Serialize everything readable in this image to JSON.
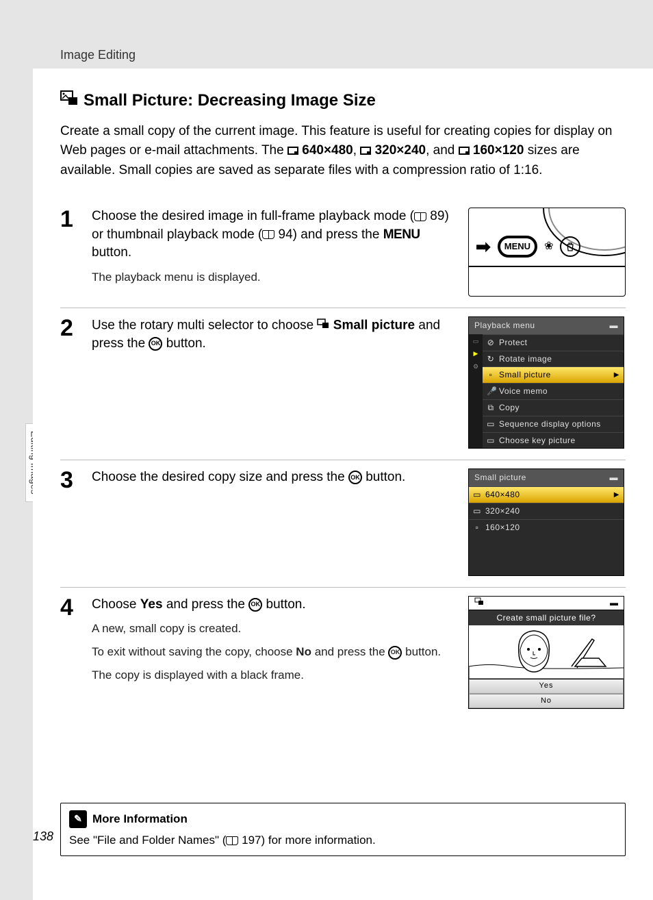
{
  "header": {
    "breadcrumb": "Image Editing"
  },
  "title": "Small Picture: Decreasing Image Size",
  "intro": {
    "text_before_sizes": "Create a small copy of the current image. This feature is useful for creating copies for display on Web pages or e-mail attachments. The ",
    "size1": "640×480",
    "between1": ", ",
    "size2": "320×240",
    "between2": ", and ",
    "size3": "160×120",
    "text_after_sizes": " sizes are available. Small copies are saved as separate files with a compression ratio of 1:16."
  },
  "steps": [
    {
      "num": "1",
      "main_a": "Choose the desired image in full-frame playback mode (",
      "ref1": "89",
      "main_b": ") or thumbnail playback mode (",
      "ref2": "94",
      "main_c": ") and press the ",
      "menu_word": "MENU",
      "main_d": " button.",
      "sub": "The playback menu is displayed.",
      "figure": "camera"
    },
    {
      "num": "2",
      "main_a": "Use the rotary multi selector to choose ",
      "bold1": "Small picture",
      "main_b": " and press the ",
      "main_c": " button.",
      "figure": "playback_menu"
    },
    {
      "num": "3",
      "main_a": "Choose the desired copy size and press the ",
      "main_b": " button.",
      "figure": "size_menu"
    },
    {
      "num": "4",
      "main_a": "Choose ",
      "bold1": "Yes",
      "main_b": " and press the ",
      "main_c": " button.",
      "sub1": "A new, small copy is created.",
      "sub2a": "To exit without saving the copy, choose ",
      "sub2_bold": "No",
      "sub2b": " and press the ",
      "sub2c": " button.",
      "sub3": "The copy is displayed with a black frame.",
      "figure": "confirm"
    }
  ],
  "camera": {
    "menu_label": "MENU"
  },
  "playback_menu": {
    "title": "Playback menu",
    "items": [
      {
        "icon": "⊘",
        "label": "Protect"
      },
      {
        "icon": "↻",
        "label": "Rotate image"
      },
      {
        "icon": "▫",
        "label": "Small picture",
        "selected": true
      },
      {
        "icon": "🎤",
        "label": "Voice memo"
      },
      {
        "icon": "⧉",
        "label": "Copy"
      },
      {
        "icon": "▭",
        "label": "Sequence display options"
      },
      {
        "icon": "▭",
        "label": "Choose key picture"
      }
    ]
  },
  "size_menu": {
    "title": "Small picture",
    "items": [
      {
        "icon": "▭",
        "label": "640×480",
        "selected": true
      },
      {
        "icon": "▭",
        "label": "320×240"
      },
      {
        "icon": "▫",
        "label": "160×120"
      }
    ]
  },
  "confirm": {
    "question": "Create small picture file?",
    "yes": "Yes",
    "no": "No"
  },
  "side_tab": "Editing Images",
  "more_info": {
    "title": "More Information",
    "text_a": "See \"File and Folder Names\" (",
    "ref": "197",
    "text_b": ") for more information."
  },
  "page_number": "138"
}
